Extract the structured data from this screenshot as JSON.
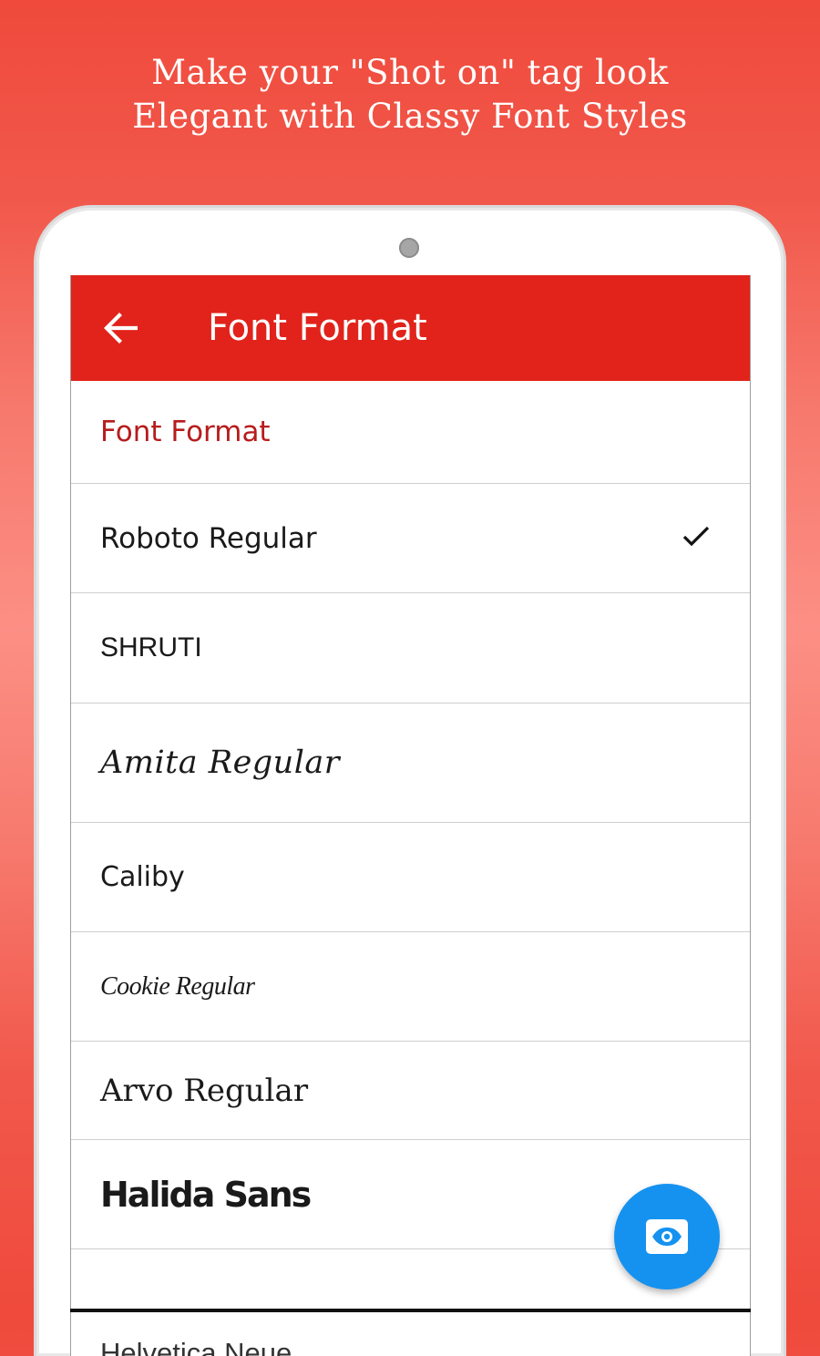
{
  "headline": {
    "line1": "Make your \"Shot on\" tag look",
    "line2": "Elegant with Classy Font Styles"
  },
  "appbar": {
    "title": "Font Format",
    "back_icon": "arrow-left-icon",
    "color": "#e1231b"
  },
  "preference_category": "Font Format",
  "font_options": [
    {
      "label": "Roboto Regular",
      "selected": true
    },
    {
      "label": "SHRUTI",
      "selected": false
    },
    {
      "label": "Amita Regular",
      "selected": false
    },
    {
      "label": "Caliby",
      "selected": false
    },
    {
      "label": "Cookie Regular",
      "selected": false
    },
    {
      "label": "Arvo Regular",
      "selected": false
    },
    {
      "label": "Halida Sans",
      "selected": false
    },
    {
      "label": "Helvetica Neue",
      "selected": false
    }
  ],
  "check_icon": "checkmark-icon",
  "fab": {
    "icon": "eye-icon",
    "color": "#1592f0"
  },
  "colors": {
    "background": "#ef4a3c",
    "category_text": "#b71c1c",
    "white": "#ffffff"
  }
}
